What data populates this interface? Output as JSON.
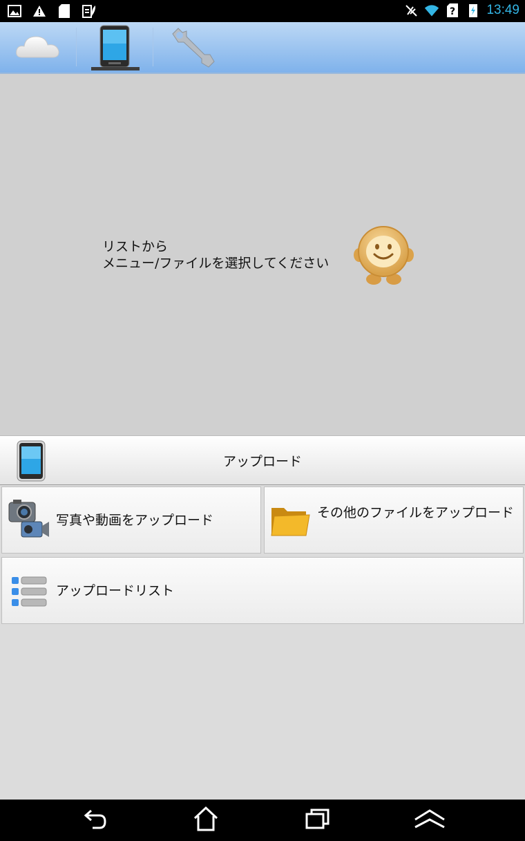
{
  "status_bar": {
    "left_icons": [
      "gallery-icon",
      "warning-icon",
      "sd-card-icon",
      "battery-leaf-icon"
    ],
    "right_icons": [
      "mute-icon",
      "wifi-icon",
      "sim-unknown-icon",
      "battery-charging-icon"
    ],
    "time": "13:49",
    "accent_color": "#33b5e5"
  },
  "tabs": [
    {
      "icon": "cloud-icon",
      "selected": false
    },
    {
      "icon": "tablet-icon",
      "selected": true
    },
    {
      "icon": "wrench-icon",
      "selected": false
    }
  ],
  "main": {
    "message_line1": "リストから",
    "message_line2": "メニュー/ファイルを選択してください",
    "mascot_icon": "smiley-mascot-icon"
  },
  "section": {
    "title": "アップロード",
    "icon": "tablet-icon"
  },
  "actions": {
    "upload_media": {
      "label": "写真や動画をアップロード",
      "icon": "camera-video-icon"
    },
    "upload_files": {
      "label": "その他のファイルをアップロード",
      "icon": "folder-icon"
    },
    "upload_list": {
      "label": "アップロードリスト",
      "icon": "list-icon"
    }
  },
  "nav_bar": [
    "back-icon",
    "home-icon",
    "recent-apps-icon",
    "menu-up-icon"
  ]
}
